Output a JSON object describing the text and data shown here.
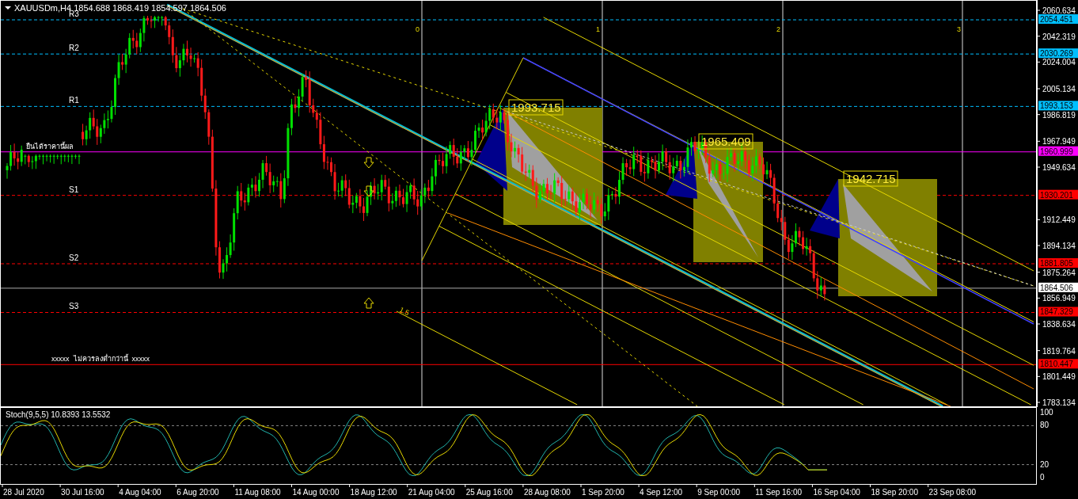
{
  "chart": {
    "title": "XAUUSDm,H4 1854.688 1868.419 1854.597 1864.506",
    "pivot_levels": [
      {
        "label": "R3",
        "price": "2054.451",
        "color": "#00bfff"
      },
      {
        "label": "R2",
        "price": "2030.269",
        "color": "#00bfff"
      },
      {
        "label": "R1",
        "price": "1993.153",
        "color": "#00bfff"
      },
      {
        "label": "S1",
        "price": "1930.201",
        "color": "#ff0000"
      },
      {
        "label": "S2",
        "price": "1881.805",
        "color": "#ff0000"
      },
      {
        "label": "S3",
        "price": "1847.329",
        "color": "#ff0000"
      }
    ],
    "notes": [
      {
        "text": "ยืนได้ราคานี้ผล",
        "price": "1960.999",
        "color": "#ff00ff"
      },
      {
        "text": "xxxxx  ไม่ควรลงต่ำกว่านี้  xxxxx",
        "price": "1810.447",
        "color": "#ff0000"
      }
    ],
    "current_price": "1864.506",
    "zone_labels": [
      "1993.715",
      "1965.409",
      "1942.715"
    ],
    "fib_time_labels": [
      "0",
      "1",
      "2",
      "3"
    ],
    "fib_level_label": "1.5"
  },
  "price_axis": {
    "ticks": [
      "2060.634",
      "2042.319",
      "2024.004",
      "2005.134",
      "1986.819",
      "1967.949",
      "1949.634",
      "1912.449",
      "1894.134",
      "1875.264",
      "1856.949",
      "1838.634",
      "1819.764",
      "1801.449",
      "1783.134"
    ]
  },
  "stochastic": {
    "title": "Stoch(9,5,5) 10.8393 13.5532",
    "ticks": [
      "100",
      "80",
      "20",
      "0"
    ]
  },
  "time_axis": {
    "labels": [
      "28 Jul 2020",
      "30 Jul 16:00",
      "4 Aug 04:00",
      "6 Aug 20:00",
      "11 Aug 08:00",
      "14 Aug 00:00",
      "18 Aug 12:00",
      "21 Aug 04:00",
      "25 Aug 16:00",
      "28 Aug 08:00",
      "1 Sep 20:00",
      "4 Sep 12:00",
      "9 Sep 00:00",
      "11 Sep 16:00",
      "16 Sep 04:00",
      "18 Sep 20:00",
      "23 Sep 08:00"
    ]
  }
}
